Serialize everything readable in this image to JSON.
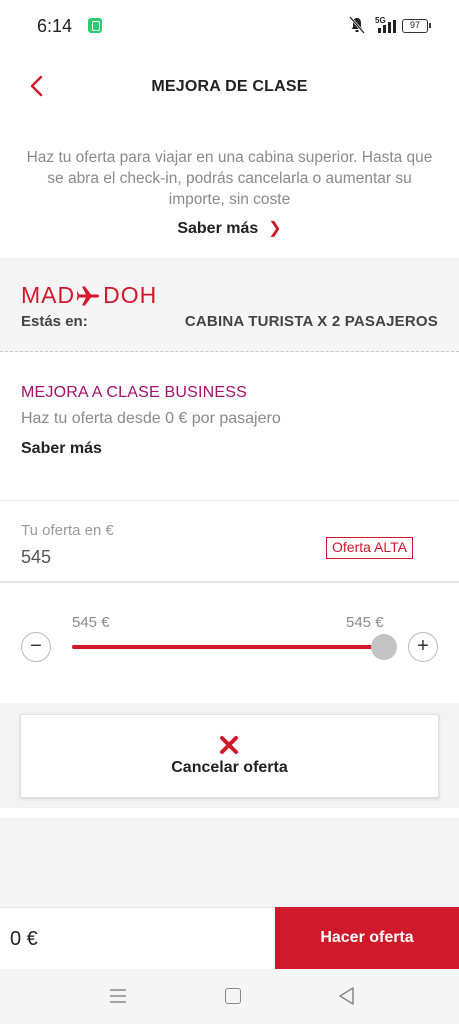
{
  "status_bar": {
    "time": "6:14",
    "network": "5G",
    "battery": "97"
  },
  "header": {
    "title": "MEJORA DE CLASE"
  },
  "intro": {
    "text": "Haz tu oferta para viajar en una cabina superior. Hasta que se abra el check-in, podrás cancelarla o aumentar su importe, sin coste",
    "learn_more": "Saber más"
  },
  "route": {
    "origin": "MAD",
    "destination": "DOH",
    "status_label": "Estás en:",
    "cabin": "CABINA TURISTA X 2 PASAJEROS"
  },
  "upgrade": {
    "title": "MEJORA A CLASE BUSINESS",
    "description": "Haz tu oferta desde 0 € por pasajero",
    "learn_more": "Saber más"
  },
  "offer": {
    "label": "Tu oferta en €",
    "value": "545",
    "badge": "Oferta ALTA"
  },
  "slider": {
    "min_label": "545 €",
    "max_label": "545 €",
    "minus": "−",
    "plus": "+",
    "level": 1.0
  },
  "cancel": {
    "label": "Cancelar oferta"
  },
  "footer": {
    "total": "0 €",
    "submit": "Hacer oferta"
  },
  "colors": {
    "accent": "#d0192b",
    "upgrade_title": "#a5106b"
  },
  "icons": {
    "back": "chevron-left-icon",
    "learn_more": "chevron-right-icon",
    "route": "plane-icon",
    "cancel": "close-icon"
  }
}
